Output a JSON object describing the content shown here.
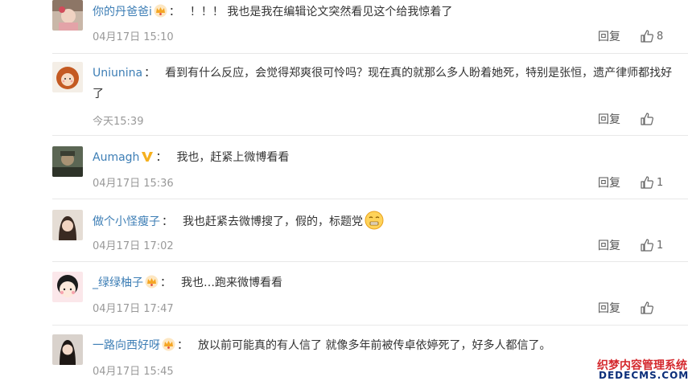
{
  "comments": [
    {
      "username": "你的丹爸爸i",
      "badge": "vip-crown-icon",
      "text": "！！！ 我也是我在编辑论文突然看见这个给我惊着了",
      "time": "04月17日 15:10",
      "reply_label": "回复",
      "likes": "8"
    },
    {
      "username": "Uniunina",
      "badge": "",
      "text": "看到有什么反应，会觉得郑爽很可怜吗？现在真的就那么多人盼着她死，特别是张恒，遗产律师都找好了",
      "time": "今天15:39",
      "reply_label": "回复",
      "likes": ""
    },
    {
      "username": "Aumagh",
      "badge": "verified-v-icon",
      "text": "我也，赶紧上微博看看",
      "time": "04月17日 15:36",
      "reply_label": "回复",
      "likes": "1"
    },
    {
      "username": "做个小怪瘦子",
      "badge": "",
      "text": "我也赶紧去微博搜了，假的，标题党",
      "emoji": "grimace-emoji-icon",
      "time": "04月17日 17:02",
      "reply_label": "回复",
      "likes": "1"
    },
    {
      "username": "_绿绿柚子",
      "badge": "vip-crown-icon",
      "text": "我也…跑来微博看看",
      "time": "04月17日 17:47",
      "reply_label": "回复",
      "likes": ""
    },
    {
      "username": "一路向西好呀",
      "badge": "vip-crown-icon",
      "text": "放以前可能真的有人信了 就像多年前被传卓依婷死了，好多人都信了。",
      "time": "04月17日 15:45",
      "reply_label": "回复",
      "likes": ""
    }
  ],
  "watermark": {
    "line1": "织梦内容管理系统",
    "line2": "DEDECMS.COM"
  },
  "colors": {
    "username": "#3d7eb5",
    "timestamp": "#999999",
    "vip_crown": "#f5a623"
  }
}
